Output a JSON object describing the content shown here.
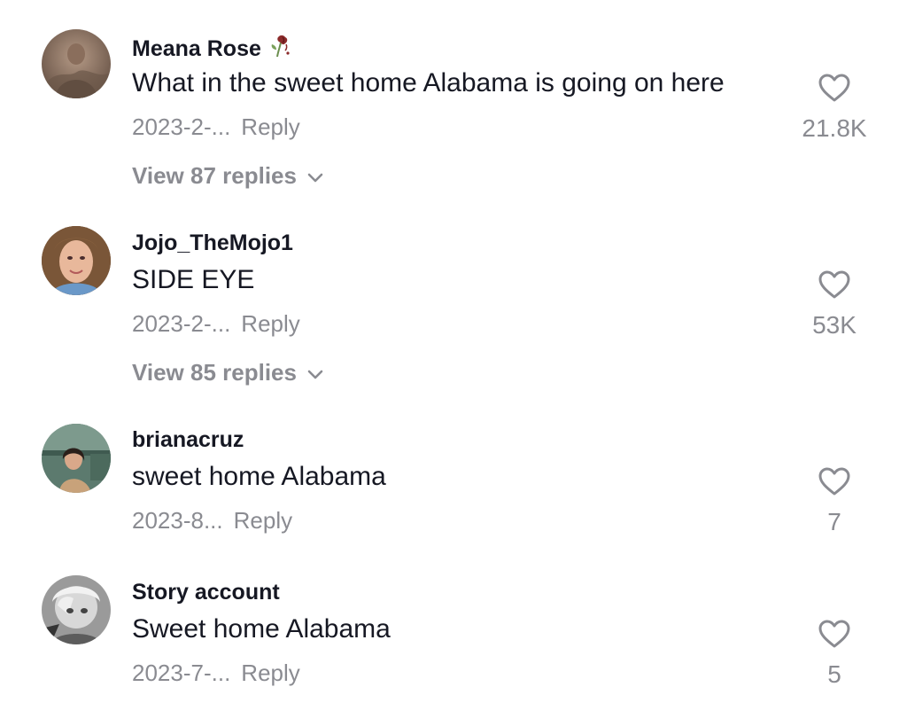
{
  "comments": [
    {
      "username": "Meana Rose",
      "username_emoji": "wilted-rose-icon",
      "text": "What in the sweet home Alabama is going on here",
      "date": "2023-2-...",
      "reply_label": "Reply",
      "likes": "21.8K",
      "view_replies": "View 87 replies"
    },
    {
      "username": "Jojo_TheMojo1",
      "text": "SIDE EYE",
      "date": "2023-2-...",
      "reply_label": "Reply",
      "likes": "53K",
      "view_replies": "View 85 replies"
    },
    {
      "username": "brianacruz",
      "text": "sweet home Alabama",
      "date": "2023-8...",
      "reply_label": "Reply",
      "likes": "7"
    },
    {
      "username": "Story account",
      "text": "Sweet home Alabama",
      "date": "2023-7-...",
      "reply_label": "Reply",
      "likes": "5"
    }
  ],
  "colors": {
    "primary_text": "#161823",
    "secondary_text": "#8a8b91",
    "background": "#ffffff"
  }
}
